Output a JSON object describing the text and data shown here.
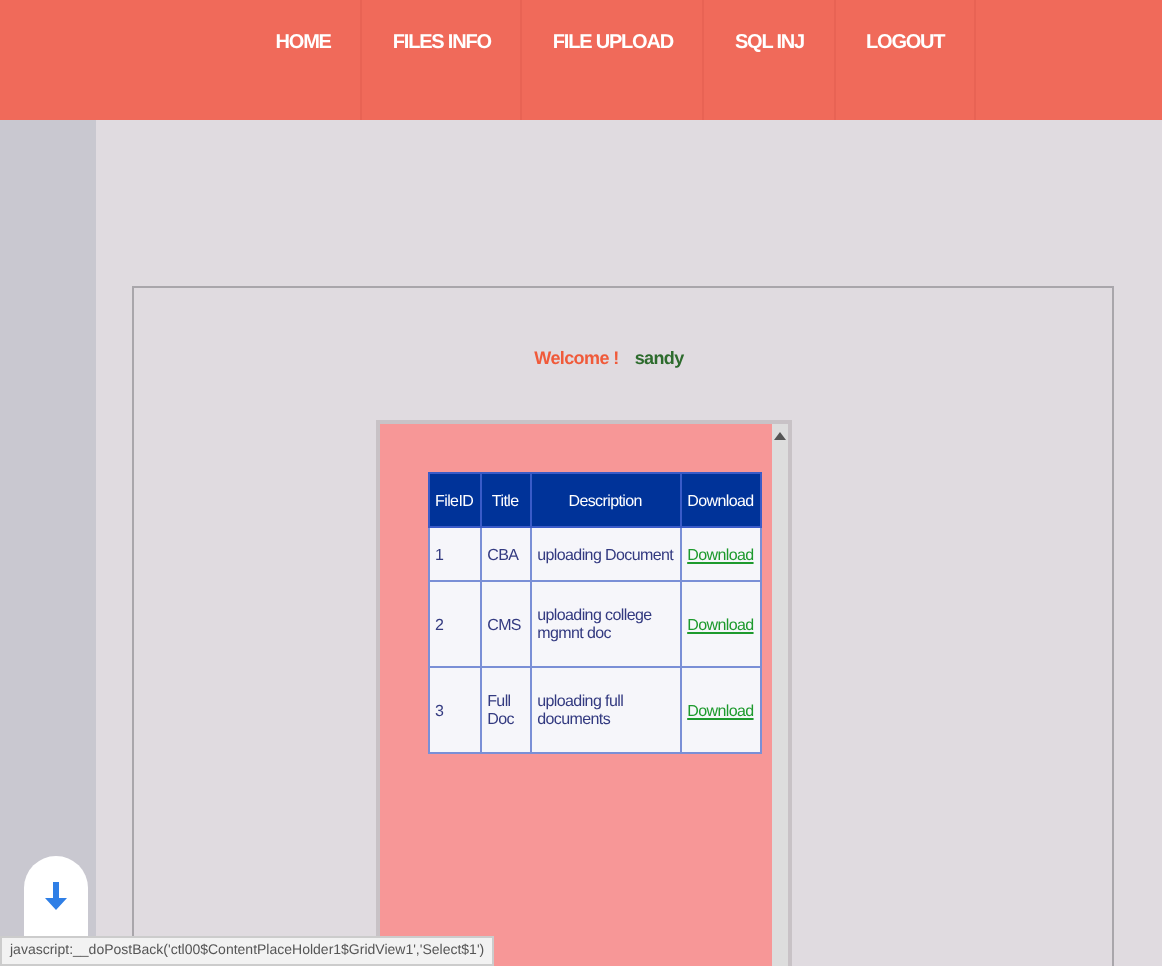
{
  "nav": {
    "items": [
      {
        "label": "HOME"
      },
      {
        "label": "FILES INFO"
      },
      {
        "label": "FILE UPLOAD"
      },
      {
        "label": "SQL INJ"
      },
      {
        "label": "LOGOUT"
      }
    ]
  },
  "welcome": {
    "label": "Welcome !",
    "user": "sandy"
  },
  "table": {
    "columns": [
      "FileID",
      "Title",
      "Description",
      "Download"
    ],
    "rows": [
      {
        "cells": [
          "1",
          "CBA",
          "uploading Document",
          "Download"
        ]
      },
      {
        "cells": [
          "2",
          "CMS",
          "uploading college mgmnt doc",
          "Download"
        ]
      },
      {
        "cells": [
          "3",
          "Full Doc",
          "uploading full documents",
          "Download"
        ]
      }
    ]
  },
  "status_bar": {
    "text": "javascript:__doPostBack('ctl00$ContentPlaceHolder1$GridView1','Select$1')"
  }
}
